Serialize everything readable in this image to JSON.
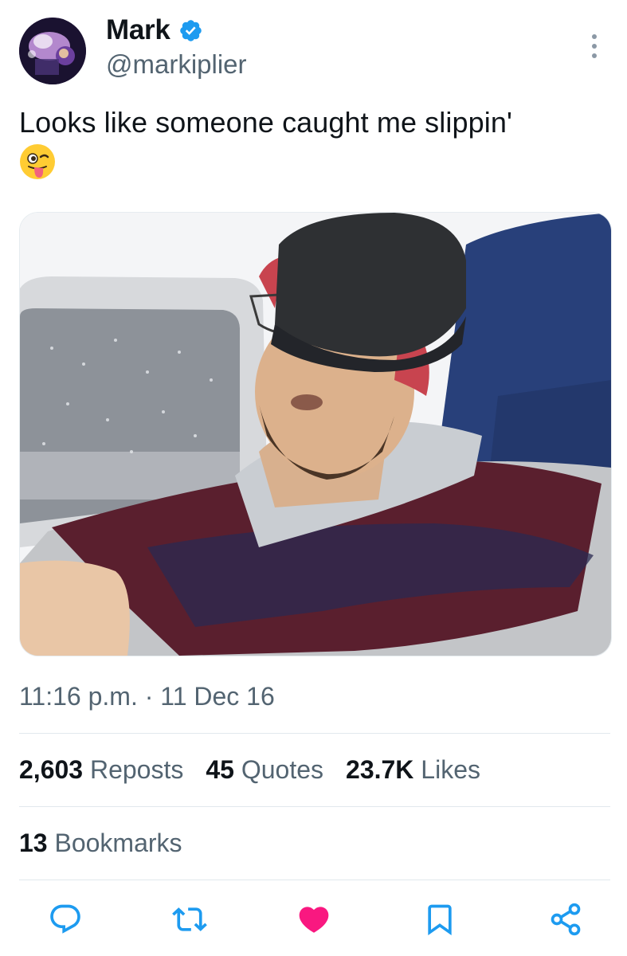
{
  "author": {
    "display_name": "Mark",
    "handle": "@markiplier",
    "verified": true,
    "verified_icon": "verified-badge-icon",
    "avatar_icon": "profile-avatar"
  },
  "tweet": {
    "text": "Looks like someone caught me slippin'",
    "emoji_icon": "winking-face-with-tongue-emoji",
    "media_icon": "photo-man-sleeping-on-plane"
  },
  "meta": {
    "timestamp": "11:16 p.m. · 11 Dec 16"
  },
  "stats": {
    "reposts_count": "2,603",
    "reposts_label": "Reposts",
    "quotes_count": "45",
    "quotes_label": "Quotes",
    "likes_count": "23.7K",
    "likes_label": "Likes",
    "bookmarks_count": "13",
    "bookmarks_label": "Bookmarks"
  },
  "actions": {
    "reply_icon": "reply-icon",
    "repost_icon": "repost-icon",
    "like_icon": "heart-icon",
    "bookmark_icon": "bookmark-icon",
    "share_icon": "share-icon",
    "more_icon": "more-options-icon"
  },
  "colors": {
    "text_primary": "#0f1419",
    "text_secondary": "#536471",
    "verified_blue": "#1d9bf0",
    "like_pink": "#f91880",
    "divider": "#e1e8ed"
  }
}
